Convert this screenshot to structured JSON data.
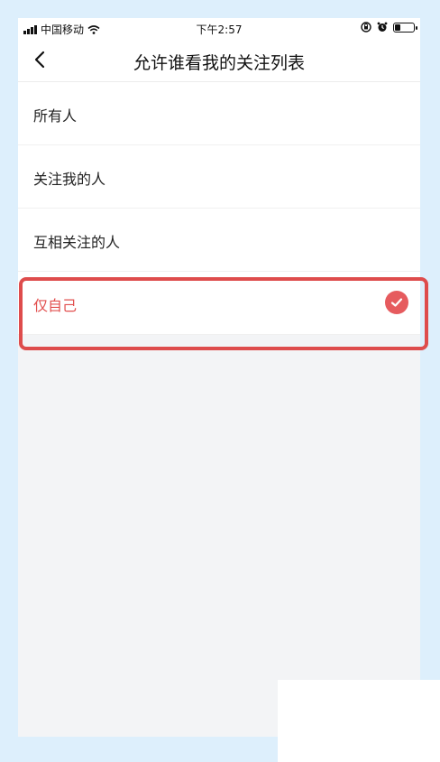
{
  "status_bar": {
    "carrier": "中国移动",
    "time": "下午2:57",
    "icons": [
      "signal-icon",
      "wifi-icon",
      "rotation-lock-icon",
      "alarm-icon",
      "battery-icon"
    ],
    "battery_level": 0.3
  },
  "nav": {
    "back_icon": "chevron-left-icon",
    "title": "允许谁看我的关注列表"
  },
  "options": [
    {
      "label": "所有人",
      "selected": false
    },
    {
      "label": "关注我的人",
      "selected": false
    },
    {
      "label": "互相关注的人",
      "selected": false
    },
    {
      "label": "仅自己",
      "selected": true
    }
  ],
  "colors": {
    "accent": "#e2504f",
    "highlight_border": "#de4c4c",
    "background": "#f3f4f6",
    "frame": "#ddeffc"
  },
  "selected_icon": "checkmark-circle-icon"
}
